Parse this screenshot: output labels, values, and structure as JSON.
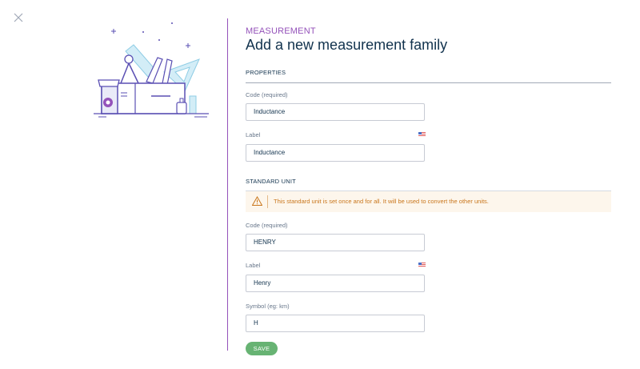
{
  "header": {
    "eyebrow": "MEASUREMENT",
    "title": "Add a new measurement family"
  },
  "properties": {
    "section_title": "PROPERTIES",
    "code_label": "Code (required)",
    "code_value": "Inductance",
    "label_label": "Label",
    "label_value": "Inductance"
  },
  "standard_unit": {
    "section_title": "STANDARD UNIT",
    "warning": "This standard unit is set once and for all. It will be used to convert the other units.",
    "code_label": "Code (required)",
    "code_value": "HENRY",
    "label_label": "Label",
    "label_value": "Henry",
    "symbol_label": "Symbol (eg: km)",
    "symbol_value": "H"
  },
  "actions": {
    "save_label": "SAVE"
  },
  "icons": {
    "close": "close-icon",
    "flag": "us-flag-icon",
    "warning": "warning-icon",
    "illustration": "toolbox-illustration"
  },
  "colors": {
    "accent": "#9452ba",
    "text": "#11324d",
    "muted": "#67768a",
    "success": "#67b373",
    "warning_bg": "#fdf6ec",
    "warning_text": "#c9761c"
  }
}
